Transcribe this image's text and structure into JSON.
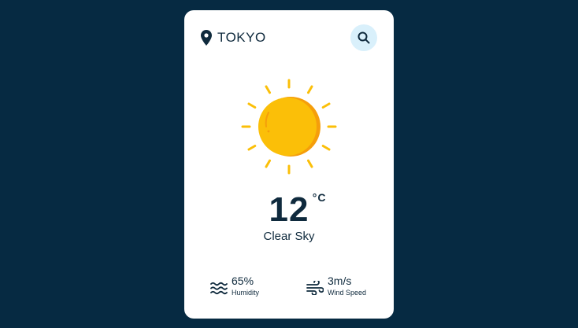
{
  "location": {
    "city": "TOKYO",
    "icon": "location-pin-icon"
  },
  "search": {
    "icon": "search-icon"
  },
  "weather": {
    "icon": "sun-icon",
    "temperature": "12",
    "unit": "°C",
    "description": "Clear Sky"
  },
  "stats": {
    "humidity": {
      "value": "65%",
      "label": "Humidity",
      "icon": "humidity-waves-icon"
    },
    "wind": {
      "value": "3m/s",
      "label": "Wind Speed",
      "icon": "wind-icon"
    }
  },
  "colors": {
    "background": "#062a42",
    "card": "#ffffff",
    "text": "#0f2a3d",
    "search_button": "#d9f0fb",
    "sun": "#fbbf08",
    "sun_shade": "#f59e0b"
  }
}
